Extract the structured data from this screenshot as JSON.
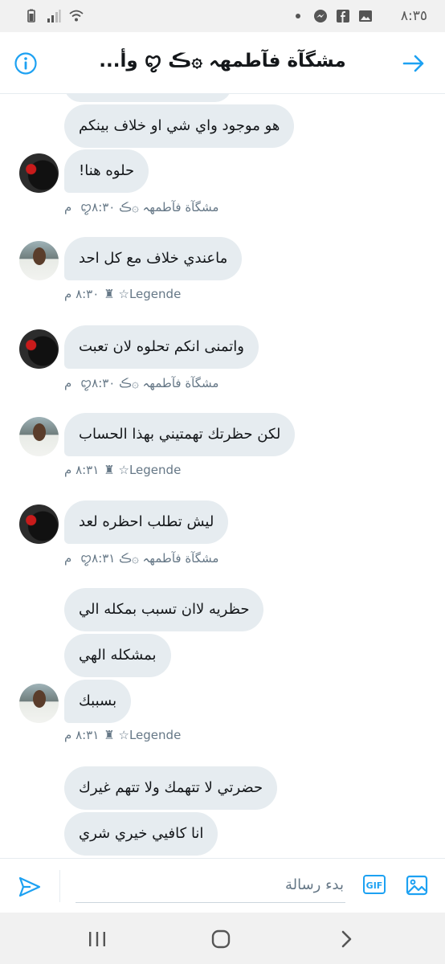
{
  "status_bar": {
    "time": "٨:٣٥",
    "icons": [
      "battery-icon",
      "signal-icon",
      "wifi-icon",
      "dots-icon",
      "messenger-icon",
      "facebook-icon",
      "gallery-icon"
    ]
  },
  "header": {
    "title": "مشگآة فآطمهہ ۞ڪ ꨄ وأ...",
    "info_icon": "info-icon",
    "back_icon": "arrow-right-icon"
  },
  "messages": [
    {
      "text": "هو موجود واي شي او خلاف بينكم",
      "sender": "female"
    },
    {
      "text": "حلوه هنا!",
      "sender": "female"
    },
    {
      "text": "ماعندي خلاف مع كل احد",
      "sender": "male"
    },
    {
      "text": "واتمنى انكم تحلوه لان تعبت",
      "sender": "female"
    },
    {
      "text": "لكن حظرتك تهمتيني بهذا الحساب",
      "sender": "male"
    },
    {
      "text": "ليش تطلب احظره لعد",
      "sender": "female"
    },
    {
      "text": "حظريه لاان تسبب بمكله الي",
      "sender": "male"
    },
    {
      "text": "بمشكله الهي",
      "sender": "male"
    },
    {
      "text": "بسببك",
      "sender": "male"
    },
    {
      "text": "حضرتي لا تتهمك ولا تتهم غيرك",
      "sender": "female"
    },
    {
      "text": "انا كافيي خيري شري",
      "sender": "female"
    }
  ],
  "meta": [
    {
      "name": "مشگآة فآطمهہ ۞ڪ ꨄ",
      "time": "٨:٣٠ م"
    },
    {
      "name": "Legende☆ ♜",
      "time": "٨:٣٠ م"
    },
    {
      "name": "مشگآة فآطمهہ ۞ڪ ꨄ",
      "time": "٨:٣٠ م"
    },
    {
      "name": "Legende☆ ♜",
      "time": "٨:٣١ م"
    },
    {
      "name": "مشگآة فآطمهہ ۞ڪ ꨄ",
      "time": "٨:٣١ م"
    },
    {
      "name": "Legende☆ ♜",
      "time": "٨:٣١ م"
    }
  ],
  "composer": {
    "placeholder": "بدء رسالة",
    "gif_label": "GIF"
  },
  "colors": {
    "accent": "#1da1f2",
    "bubble": "#e6ecf0",
    "meta_text": "#657786"
  }
}
